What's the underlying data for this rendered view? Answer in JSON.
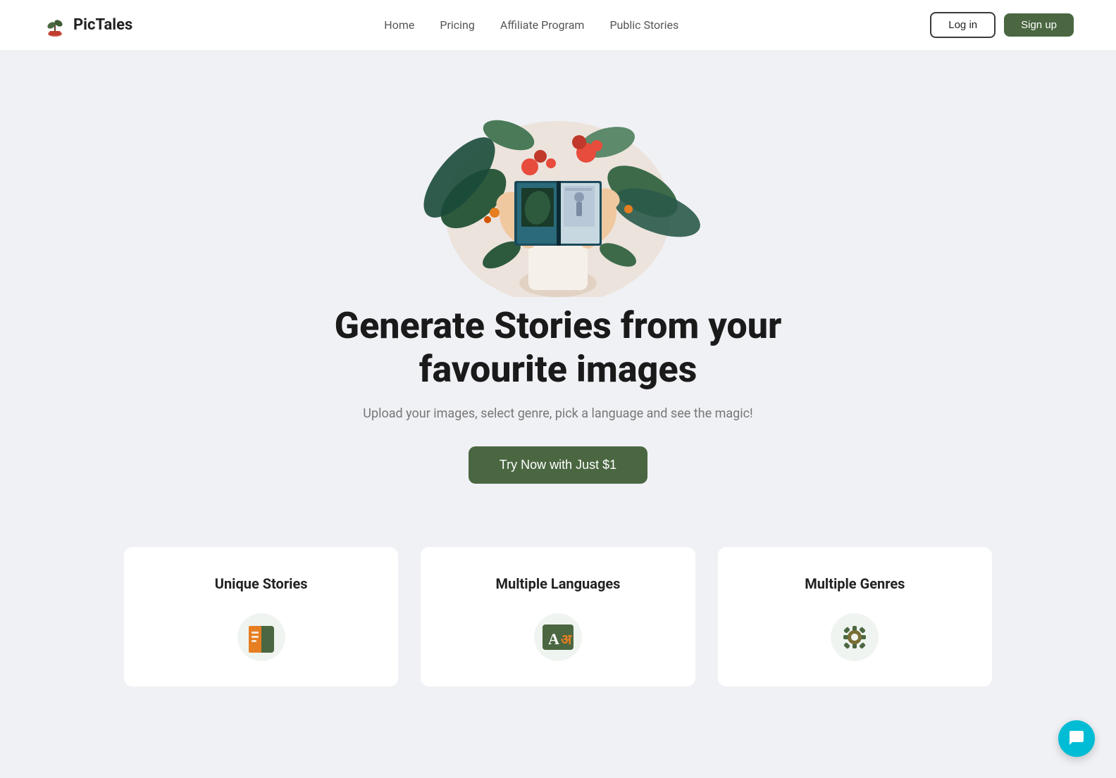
{
  "navbar": {
    "logo_text": "PicTales",
    "nav_links": [
      {
        "label": "Home",
        "id": "home"
      },
      {
        "label": "Pricing",
        "id": "pricing"
      },
      {
        "label": "Affiliate Program",
        "id": "affiliate"
      },
      {
        "label": "Public Stories",
        "id": "public-stories"
      }
    ],
    "login_label": "Log in",
    "signup_label": "Sign up"
  },
  "hero": {
    "title_line1": "Generate Stories from your",
    "title_line2": "favourite images",
    "subtitle": "Upload your images, select genre, pick a language and see the magic!",
    "cta_label": "Try Now with Just $1"
  },
  "features": [
    {
      "title": "Unique Stories",
      "id": "unique-stories"
    },
    {
      "title": "Multiple Languages",
      "id": "multiple-languages"
    },
    {
      "title": "Multiple Genres",
      "id": "multiple-genres"
    }
  ],
  "colors": {
    "primary_green": "#4a6741",
    "accent_teal": "#00bcd4",
    "text_dark": "#1a1a1a",
    "text_muted": "#777777",
    "bg": "#f0f1f5"
  }
}
